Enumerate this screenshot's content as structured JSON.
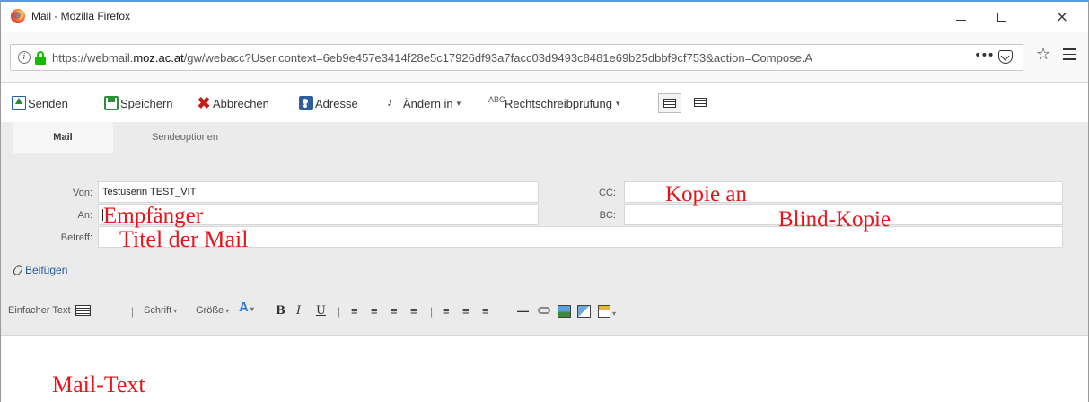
{
  "window": {
    "title": "Mail - Mozilla Firefox",
    "min_label": "–",
    "close_label": "×"
  },
  "browser": {
    "url_prefix": "https://webmail.",
    "url_domain": "moz.ac.at",
    "url_suffix": "/gw/webacc?User.context=6eb9e457e3414f28e5c17926df93a7facc03d9493c8481e69b25dbbf9cf753&action=Compose.A",
    "more_label": "•••",
    "star_label": "☆",
    "info_label": "i"
  },
  "toolbar": {
    "send": "Senden",
    "save": "Speichern",
    "cancel": "Abbrechen",
    "address": "Adresse",
    "change_to": "Ändern in",
    "spellcheck": "Rechtschreibprüfung",
    "cancel_glyph": "✖",
    "change_glyph": "♪",
    "spell_glyph": "ABC"
  },
  "tabs": {
    "mail": "Mail",
    "send_options": "Sendeoptionen"
  },
  "form": {
    "from_label": "Von:",
    "from_value": "Testuserin TEST_VIT",
    "to_label": "An:",
    "subject_label": "Betreff:",
    "cc_label": "CC:",
    "bc_label": "BC:",
    "attach_label": "Beifügen"
  },
  "annotations": {
    "cc": "Kopie an",
    "to": "Empfänger",
    "bc": "Blind-Kopie",
    "subject": "Titel der Mail",
    "body": "Mail-Text",
    "color": "#e8141b"
  },
  "format_toolbar": {
    "plain_text": "Einfacher Text",
    "font": "Schrift",
    "size": "Größe",
    "sep": "|",
    "bold": "B",
    "italic": "I",
    "underline": "U",
    "caret": "▾",
    "hr": "—"
  }
}
